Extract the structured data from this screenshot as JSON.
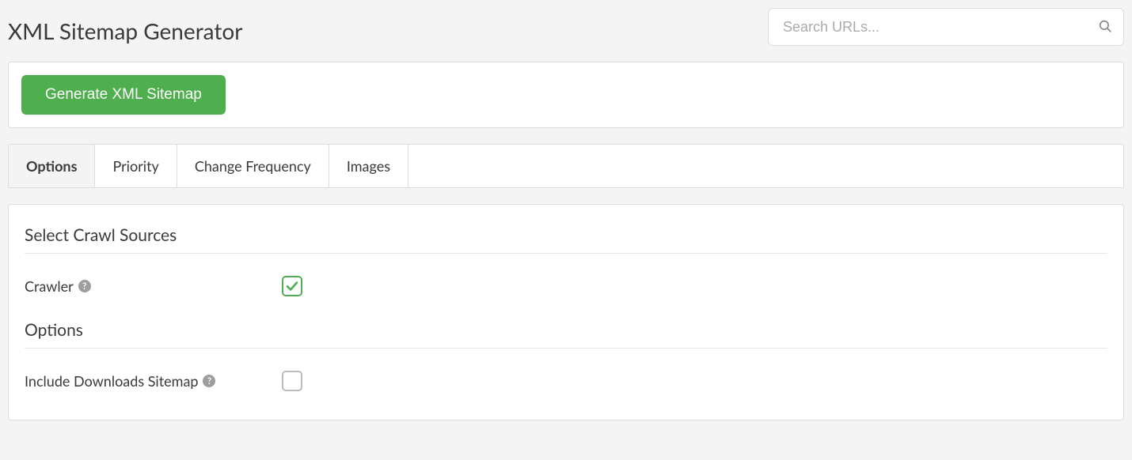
{
  "header": {
    "title": "XML Sitemap Generator",
    "search_placeholder": "Search URLs..."
  },
  "action_panel": {
    "generate_label": "Generate XML Sitemap"
  },
  "tabs": [
    {
      "label": "Options",
      "active": true
    },
    {
      "label": "Priority",
      "active": false
    },
    {
      "label": "Change Frequency",
      "active": false
    },
    {
      "label": "Images",
      "active": false
    }
  ],
  "form": {
    "section_sources": {
      "heading": "Select Crawl Sources",
      "crawler": {
        "label": "Crawler",
        "help_glyph": "?",
        "checked": true
      }
    },
    "section_options": {
      "heading": "Options",
      "include_downloads": {
        "label": "Include Downloads Sitemap",
        "help_glyph": "?",
        "checked": false
      }
    }
  }
}
